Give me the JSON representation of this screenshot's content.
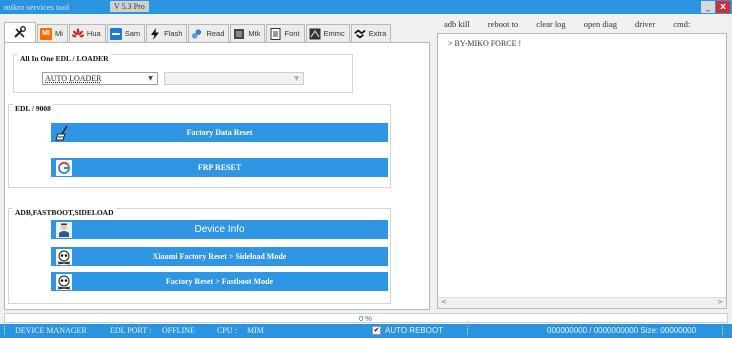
{
  "window": {
    "title": "mikro services tool",
    "version": "V 5.3 Pro",
    "minimize_glyph": "_",
    "close_glyph": "x"
  },
  "tabs": [
    {
      "label": "",
      "icon": "tools-icon"
    },
    {
      "label": "Mi",
      "icon": "mi-logo-icon",
      "icon_text": "MI"
    },
    {
      "label": "Hua",
      "icon": "huawei-logo-icon"
    },
    {
      "label": "Sam",
      "icon": "samsung-icon"
    },
    {
      "label": "Flash",
      "icon": "lightning-icon"
    },
    {
      "label": "Read",
      "icon": "read-icon"
    },
    {
      "label": "Mtk",
      "icon": "chip-icon"
    },
    {
      "label": "Font",
      "icon": "document-icon"
    },
    {
      "label": "Emmc",
      "icon": "emmc-icon"
    },
    {
      "label": "Extra",
      "icon": "handshake-icon"
    }
  ],
  "edl_loader_group": {
    "title": "All In One  EDL / LOADER",
    "loader_select_value": "AUTO LOADER",
    "second_select_value": ""
  },
  "edl_9008_group": {
    "title": "EDL / 9008",
    "factory_reset_label": "Factory Data Reset",
    "frp_reset_label": "FRP RESET"
  },
  "adb_group": {
    "title": "ADB,FASTBOOT,SIDELOAD",
    "device_info_label": "Device Info",
    "xiaomi_sideload_label": "Xiaomi Factory Reset > Sideload Mode",
    "fastboot_label": "Factory Reset > Fastboot Mode"
  },
  "console_menu": [
    "adb kill",
    "reboot to",
    "clear log",
    "open diag",
    "driver",
    "cmd:"
  ],
  "log": {
    "lines": [
      "> BY-MIKO FORCE !"
    ],
    "scroll_left_glyph": "<",
    "scroll_right_glyph": ">"
  },
  "progress": {
    "value": 0,
    "text": "0  %"
  },
  "status": {
    "device_manager": "DEVICE MANAGER",
    "edl_port_label": "EDL PORT :",
    "edl_port_value": "OFFLINE",
    "cpu_label": "CPU :",
    "cpu_value": "MIM",
    "auto_reboot_label": "AUTO REBOOT",
    "auto_reboot_checked": true,
    "check_glyph": "✔",
    "size_text": "000000000 / 0000000000 Size: 00000000"
  },
  "colors": {
    "accent": "#2a94e0",
    "button": "#2f96e6"
  }
}
